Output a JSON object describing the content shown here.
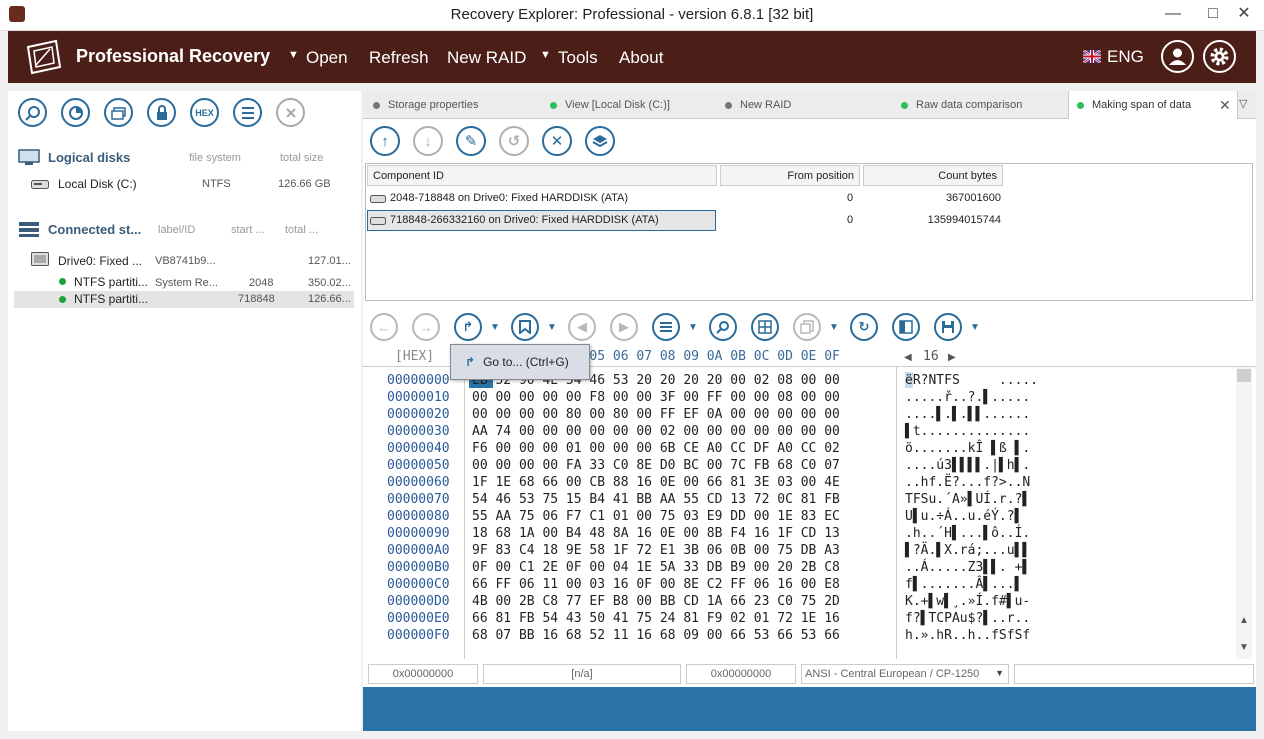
{
  "window": {
    "title": "Recovery Explorer: Professional - version 6.8.1 [32 bit]",
    "minimize": "—",
    "maximize": "□",
    "close": "✕"
  },
  "menubar": {
    "brand": "Professional Recovery",
    "items": [
      "Open",
      "Refresh",
      "New RAID",
      "Tools",
      "About"
    ],
    "language": "ENG"
  },
  "left": {
    "toolbar": [
      "search-icon",
      "disk-scan-icon",
      "image-icon",
      "lock-icon",
      "HEX",
      "list-icon",
      "close-icon"
    ],
    "hex_label": "HEX",
    "logical": {
      "title": "Logical disks",
      "col_fs": "file system",
      "col_size": "total size",
      "items": [
        {
          "name": "Local Disk (C:)",
          "fs": "NTFS",
          "size": "126.66 GB"
        }
      ]
    },
    "connected": {
      "title": "Connected st...",
      "col_label": "label/ID",
      "col_start": "start ...",
      "col_total": "total ...",
      "drive": {
        "name": "Drive0: Fixed ...",
        "id": "VB8741b9...",
        "size": "127.01..."
      },
      "partitions": [
        {
          "name": "NTFS partiti...",
          "label": "System Re...",
          "start": "2048",
          "size": "350.02..."
        },
        {
          "name": "NTFS partiti...",
          "label": "",
          "start": "718848",
          "size": "126.66..."
        }
      ]
    }
  },
  "tabs": [
    {
      "label": "Storage properties",
      "color": "#777777"
    },
    {
      "label": "View [Local Disk (C:)]",
      "color": "#2bbf5c"
    },
    {
      "label": "New RAID",
      "color": "#777777"
    },
    {
      "label": "Raw data comparison",
      "color": "#2bbf5c"
    },
    {
      "label": "Making span of data",
      "color": "#2bbf5c"
    }
  ],
  "components": {
    "headers": [
      "Component ID",
      "From position",
      "Count bytes"
    ],
    "rows": [
      {
        "id": "2048-718848 on Drive0: Fixed HARDDISK (ATA)",
        "from": "0",
        "count": "367001600"
      },
      {
        "id": "718848-266332160 on Drive0: Fixed HARDDISK (ATA)",
        "from": "0",
        "count": "135994015744"
      }
    ]
  },
  "hex": {
    "label": "[HEX]",
    "columns": "00 01 02 03 04 05 06 07 08 09 0A 0B 0C 0D 0E 0F",
    "width_label": "16",
    "rows": [
      {
        "addr": "00000000",
        "bytes": "EB 52 90 4E 54 46 53 20 20 20 20 00 02 08 00 00",
        "ascii": "ëR?NTFS     ....."
      },
      {
        "addr": "00000010",
        "bytes": "00 00 00 00 00 F8 00 00 3F 00 FF 00 00 08 00 00",
        "ascii": ".....ř..?.▌....."
      },
      {
        "addr": "00000020",
        "bytes": "00 00 00 00 80 00 80 00 FF EF 0A 00 00 00 00 00",
        "ascii": "....▌.▌.▌▌......"
      },
      {
        "addr": "00000030",
        "bytes": "AA 74 00 00 00 00 00 00 02 00 00 00 00 00 00 00",
        "ascii": "▌t.............."
      },
      {
        "addr": "00000040",
        "bytes": "F6 00 00 00 01 00 00 00 6B CE A0 CC DF A0 CC 02",
        "ascii": "ö.......kÎ ▌ß ▌."
      },
      {
        "addr": "00000050",
        "bytes": "00 00 00 00 FA 33 C0 8E D0 BC 00 7C FB 68 C0 07",
        "ascii": "....ú3▌▌▌▌.|▌h▌."
      },
      {
        "addr": "00000060",
        "bytes": "1F 1E 68 66 00 CB 88 16 0E 00 66 81 3E 03 00 4E",
        "ascii": "..hf.Ë?...f?>..N"
      },
      {
        "addr": "00000070",
        "bytes": "54 46 53 75 15 B4 41 BB AA 55 CD 13 72 0C 81 FB",
        "ascii": "TFSu.´A»▌UÍ.r.?▌"
      },
      {
        "addr": "00000080",
        "bytes": "55 AA 75 06 F7 C1 01 00 75 03 E9 DD 00 1E 83 EC",
        "ascii": "U▌u.÷Á..u.éÝ.?▌"
      },
      {
        "addr": "00000090",
        "bytes": "18 68 1A 00 B4 48 8A 16 0E 00 8B F4 16 1F CD 13",
        "ascii": ".h..´H▌...▌ô..Í."
      },
      {
        "addr": "000000A0",
        "bytes": "9F 83 C4 18 9E 58 1F 72 E1 3B 06 0B 00 75 DB A3",
        "ascii": "▌?Ä.▌X.rá;...u▌▌"
      },
      {
        "addr": "000000B0",
        "bytes": "0F 00 C1 2E 0F 00 04 1E 5A 33 DB B9 00 20 2B C8",
        "ascii": "..Á.....Z3▌▌. +▌"
      },
      {
        "addr": "000000C0",
        "bytes": "66 FF 06 11 00 03 16 0F 00 8E C2 FF 06 16 00 E8",
        "ascii": "f▌.......Â▌...▌"
      },
      {
        "addr": "000000D0",
        "bytes": "4B 00 2B C8 77 EF B8 00 BB CD 1A 66 23 C0 75 2D",
        "ascii": "K.+▌w▌¸.»Í.f#▌u-"
      },
      {
        "addr": "000000E0",
        "bytes": "66 81 FB 54 43 50 41 75 24 81 F9 02 01 72 1E 16",
        "ascii": "f?▌TCPAu$?▌..r.."
      },
      {
        "addr": "000000F0",
        "bytes": "68 07 BB 16 68 52 11 16 68 09 00 66 53 66 53 66",
        "ascii": "h.».hR..h..fSfSf"
      }
    ]
  },
  "tooltip": {
    "label": "Go to... (Ctrl+G)"
  },
  "status": {
    "offset": "0x00000000",
    "value": "[n/a]",
    "position": "0x00000000",
    "encoding": "ANSI - Central European / CP-1250"
  },
  "colors": {
    "brand": "#4b1f17",
    "accent": "#2a6b9a",
    "progress": "#2a74a8"
  }
}
